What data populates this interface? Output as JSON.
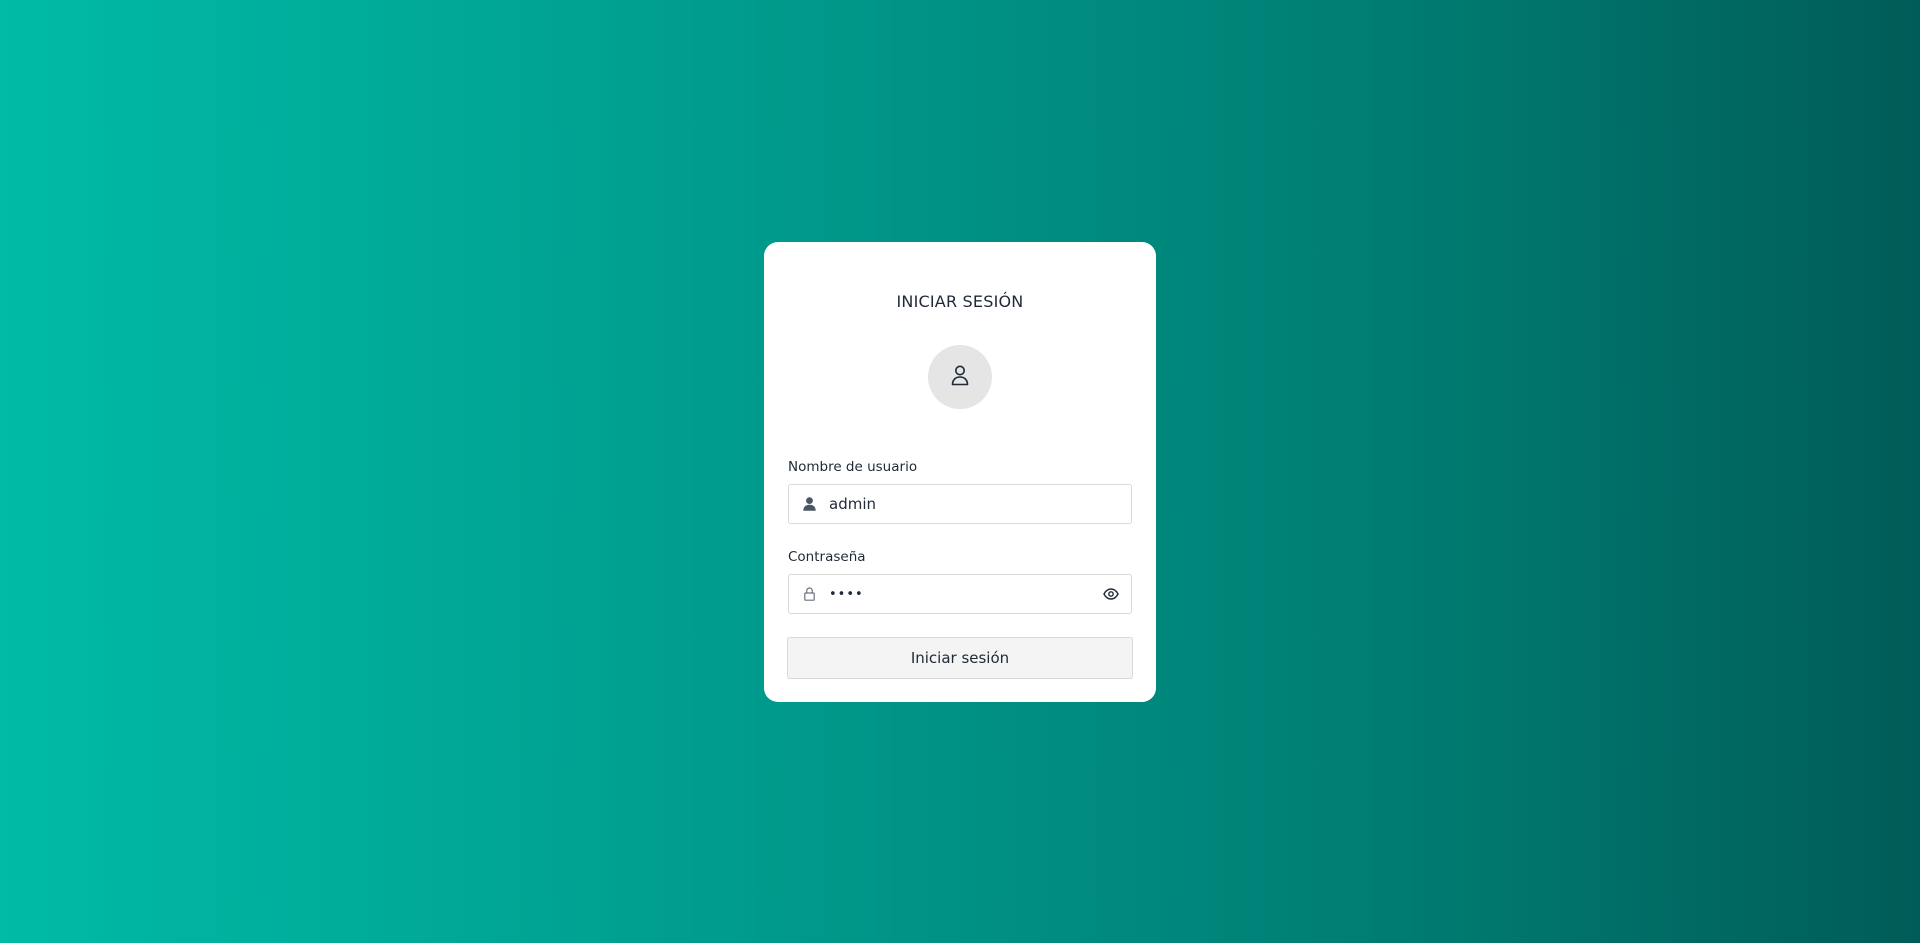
{
  "login": {
    "title": "INICIAR SESIÓN",
    "avatar_icon": "user-outline-icon",
    "username": {
      "label": "Nombre de usuario",
      "value": "admin",
      "icon": "user-solid-icon"
    },
    "password": {
      "label": "Contraseña",
      "value": "••••",
      "icon": "lock-icon",
      "toggle_icon": "eye-icon"
    },
    "submit_label": "Iniciar sesión"
  },
  "colors": {
    "background_start": "#00bba7",
    "background_end": "#005c57",
    "card": "#ffffff",
    "avatar_bg": "#e5e5e5",
    "button_bg": "#f4f4f4",
    "text": "#1f2937"
  }
}
